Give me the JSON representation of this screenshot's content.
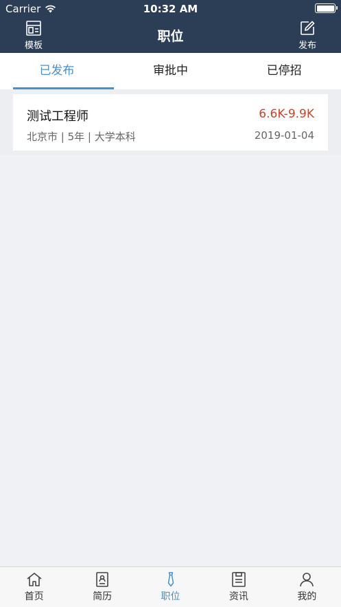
{
  "status_bar": {
    "carrier": "Carrier",
    "time": "10:32 AM"
  },
  "nav": {
    "title": "职位",
    "left_label": "模板",
    "right_label": "发布",
    "left_icon": "template-icon",
    "right_icon": "edit-icon"
  },
  "tabs": [
    {
      "label": "已发布",
      "active": true
    },
    {
      "label": "审批中",
      "active": false
    },
    {
      "label": "已停招",
      "active": false
    }
  ],
  "jobs": [
    {
      "title": "测试工程师",
      "salary": "6.6K-9.9K",
      "meta": "北京市 | 5年 | 大学本科",
      "date": "2019-01-04"
    }
  ],
  "tabbar": [
    {
      "label": "首页",
      "icon": "home-icon",
      "active": false
    },
    {
      "label": "简历",
      "icon": "resume-icon",
      "active": false
    },
    {
      "label": "职位",
      "icon": "tie-icon",
      "active": true
    },
    {
      "label": "资讯",
      "icon": "news-icon",
      "active": false
    },
    {
      "label": "我的",
      "icon": "user-icon",
      "active": false
    }
  ],
  "colors": {
    "header_bg": "#2c3e55",
    "accent": "#4a90c6",
    "salary": "#c7442d",
    "page_bg": "#f0f1f5"
  }
}
